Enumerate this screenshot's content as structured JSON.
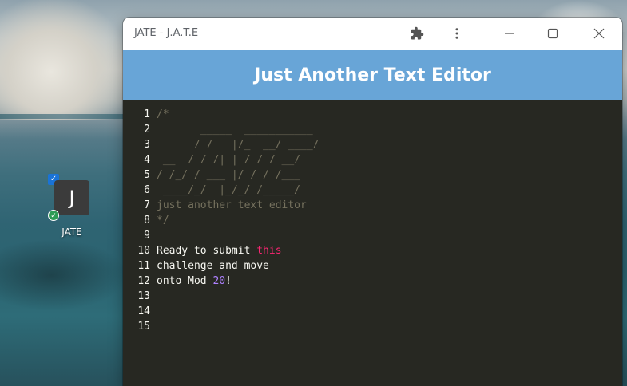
{
  "desktop": {
    "icon_letter": "J",
    "icon_label": "JATE",
    "icon_check_glyph": "✓",
    "icon_sync_glyph": "✓"
  },
  "window": {
    "title": "JATE - J.A.T.E",
    "buttons": {
      "extensions_icon": "puzzle-icon",
      "more_icon": "more-vertical-icon",
      "minimize_icon": "minimize-icon",
      "maximize_icon": "maximize-icon",
      "close_icon": "close-icon"
    }
  },
  "header": {
    "title": "Just Another Text Editor",
    "background_color": "#68a5d7"
  },
  "editor": {
    "line_numbers": [
      "1",
      "2",
      "3",
      "4",
      "5",
      "6",
      "7",
      "8",
      "9",
      "10",
      "11",
      "12",
      "13",
      "14",
      "15"
    ],
    "lines": [
      [
        {
          "t": "/*",
          "c": "cm"
        }
      ],
      [
        {
          "t": "       _____  ___________",
          "c": "cm"
        }
      ],
      [
        {
          "t": "      / /   |/_  __/ ____/",
          "c": "cm"
        }
      ],
      [
        {
          "t": " __  / / /| | / / / __/",
          "c": "cm"
        }
      ],
      [
        {
          "t": "/ /_/ / ___ |/ / / /___",
          "c": "cm"
        }
      ],
      [
        {
          "t": " ____/_/  |_/_/ /_____/",
          "c": "cm"
        }
      ],
      [
        {
          "t": "just another text editor",
          "c": "cm"
        }
      ],
      [
        {
          "t": "*/",
          "c": "cm"
        }
      ],
      [],
      [
        {
          "t": "Ready to submit ",
          "c": ""
        },
        {
          "t": "this",
          "c": "kw"
        }
      ],
      [
        {
          "t": "challenge and move",
          "c": ""
        }
      ],
      [
        {
          "t": "onto Mod ",
          "c": ""
        },
        {
          "t": "20",
          "c": "num"
        },
        {
          "t": "!",
          "c": ""
        }
      ],
      [],
      [],
      []
    ],
    "colors": {
      "background": "#272822",
      "comment": "#75715e",
      "keyword": "#f92672",
      "number": "#ae81ff",
      "text": "#f8f8f2"
    }
  }
}
